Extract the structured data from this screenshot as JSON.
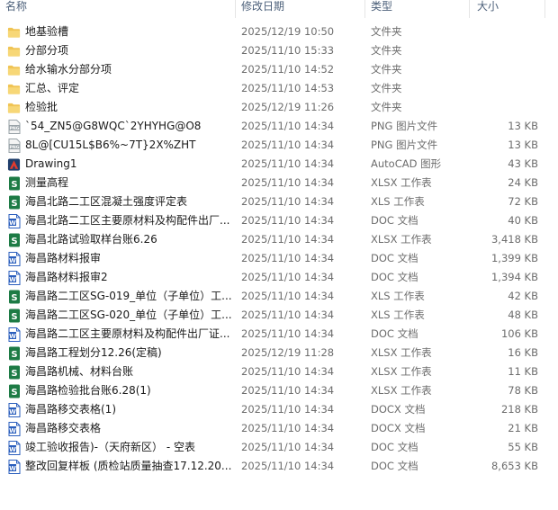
{
  "columns": {
    "name": "名称",
    "modified": "修改日期",
    "type": "类型",
    "size": "大小"
  },
  "files": [
    {
      "name": "地基验槽",
      "modified": "2025/12/19 10:50",
      "type": "文件夹",
      "size": "",
      "icon": "folder-icon"
    },
    {
      "name": "分部分项",
      "modified": "2025/11/10 15:33",
      "type": "文件夹",
      "size": "",
      "icon": "folder-icon"
    },
    {
      "name": "给水输水分部分项",
      "modified": "2025/11/10 14:52",
      "type": "文件夹",
      "size": "",
      "icon": "folder-icon"
    },
    {
      "name": "汇总、评定",
      "modified": "2025/11/10 14:53",
      "type": "文件夹",
      "size": "",
      "icon": "folder-icon"
    },
    {
      "name": "检验批",
      "modified": "2025/12/19 11:26",
      "type": "文件夹",
      "size": "",
      "icon": "folder-icon"
    },
    {
      "name": "`54_ZN5@G8WQC`2YHYHG@O8",
      "modified": "2025/11/10 14:34",
      "type": "PNG 图片文件",
      "size": "13 KB",
      "icon": "png-icon"
    },
    {
      "name": "8L@[CU15L$B6%~7T}2X%ZHT",
      "modified": "2025/11/10 14:34",
      "type": "PNG 图片文件",
      "size": "13 KB",
      "icon": "png-icon"
    },
    {
      "name": "Drawing1",
      "modified": "2025/11/10 14:34",
      "type": "AutoCAD 图形",
      "size": "43 KB",
      "icon": "autocad-icon"
    },
    {
      "name": "测量高程",
      "modified": "2025/11/10 14:34",
      "type": "XLSX 工作表",
      "size": "24 KB",
      "icon": "excel-icon"
    },
    {
      "name": "海昌北路二工区混凝土强度评定表",
      "modified": "2025/11/10 14:34",
      "type": "XLS 工作表",
      "size": "72 KB",
      "icon": "excel-icon"
    },
    {
      "name": "海昌北路二工区主要原材料及构配件出厂...",
      "modified": "2025/11/10 14:34",
      "type": "DOC 文档",
      "size": "40 KB",
      "icon": "word-icon"
    },
    {
      "name": "海昌北路试验取样台账6.26",
      "modified": "2025/11/10 14:34",
      "type": "XLSX 工作表",
      "size": "3,418 KB",
      "icon": "excel-icon"
    },
    {
      "name": "海昌路材料报审",
      "modified": "2025/11/10 14:34",
      "type": "DOC 文档",
      "size": "1,399 KB",
      "icon": "word-icon"
    },
    {
      "name": "海昌路材料报审2",
      "modified": "2025/11/10 14:34",
      "type": "DOC 文档",
      "size": "1,394 KB",
      "icon": "word-icon"
    },
    {
      "name": "海昌路二工区SG-019_单位（子单位）工...",
      "modified": "2025/11/10 14:34",
      "type": "XLS 工作表",
      "size": "42 KB",
      "icon": "excel-icon"
    },
    {
      "name": "海昌路二工区SG-020_单位（子单位）工...",
      "modified": "2025/11/10 14:34",
      "type": "XLS 工作表",
      "size": "48 KB",
      "icon": "excel-icon"
    },
    {
      "name": "海昌路二工区主要原材料及构配件出厂证...",
      "modified": "2025/11/10 14:34",
      "type": "DOC 文档",
      "size": "106 KB",
      "icon": "word-icon"
    },
    {
      "name": "海昌路工程划分12.26(定稿)",
      "modified": "2025/12/19 11:28",
      "type": "XLSX 工作表",
      "size": "16 KB",
      "icon": "excel-icon"
    },
    {
      "name": "海昌路机械、材料台账",
      "modified": "2025/11/10 14:34",
      "type": "XLSX 工作表",
      "size": "11 KB",
      "icon": "excel-icon"
    },
    {
      "name": "海昌路检验批台账6.28(1)",
      "modified": "2025/11/10 14:34",
      "type": "XLSX 工作表",
      "size": "78 KB",
      "icon": "excel-icon"
    },
    {
      "name": "海昌路移交表格(1)",
      "modified": "2025/11/10 14:34",
      "type": "DOCX 文档",
      "size": "218 KB",
      "icon": "word-icon"
    },
    {
      "name": "海昌路移交表格",
      "modified": "2025/11/10 14:34",
      "type": "DOCX 文档",
      "size": "21 KB",
      "icon": "word-icon"
    },
    {
      "name": "竣工验收报告)-（天府新区） - 空表",
      "modified": "2025/11/10 14:34",
      "type": "DOC 文档",
      "size": "55 KB",
      "icon": "word-icon"
    },
    {
      "name": "整改回复样板 (质检站质量抽查17.12.20...",
      "modified": "2025/11/10 14:34",
      "type": "DOC 文档",
      "size": "8,653 KB",
      "icon": "word-icon"
    }
  ],
  "colors": {
    "folder": "#f0c454",
    "excel": "#1d7b45",
    "word": "#2b5fbd",
    "png": "#9aa3a8",
    "autocad": "#e23b2e",
    "header_text": "#4c607a"
  }
}
